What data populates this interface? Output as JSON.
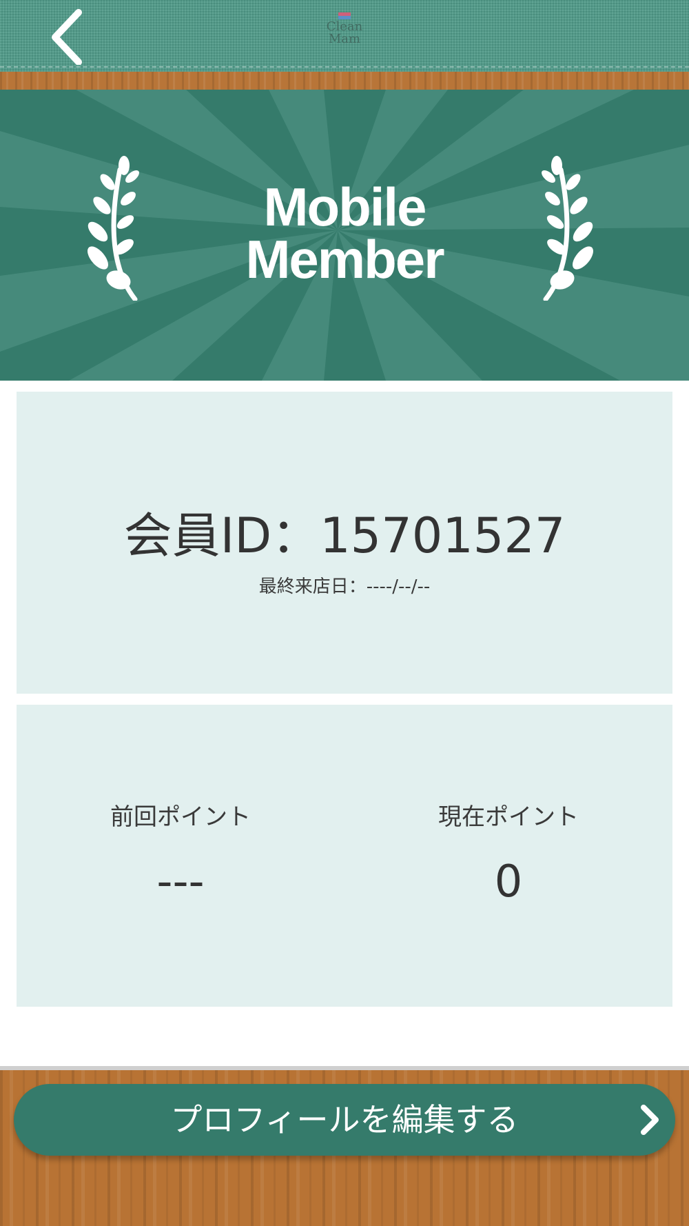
{
  "header": {
    "logo_line1": "Clean",
    "logo_line2": "Mam"
  },
  "banner": {
    "title_line1": "Mobile",
    "title_line2": "Member"
  },
  "member_card": {
    "member_id": "会員ID：15701527",
    "last_visit": "最終来店日：----/--/--"
  },
  "points_card": {
    "previous_label": "前回ポイント",
    "previous_value": "---",
    "current_label": "現在ポイント",
    "current_value": "0"
  },
  "footer": {
    "edit_profile_label": "プロフィールを編集する"
  },
  "colors": {
    "primary_green": "#357b6b",
    "card_background": "#e2f0ef",
    "wood": "#b87334"
  }
}
